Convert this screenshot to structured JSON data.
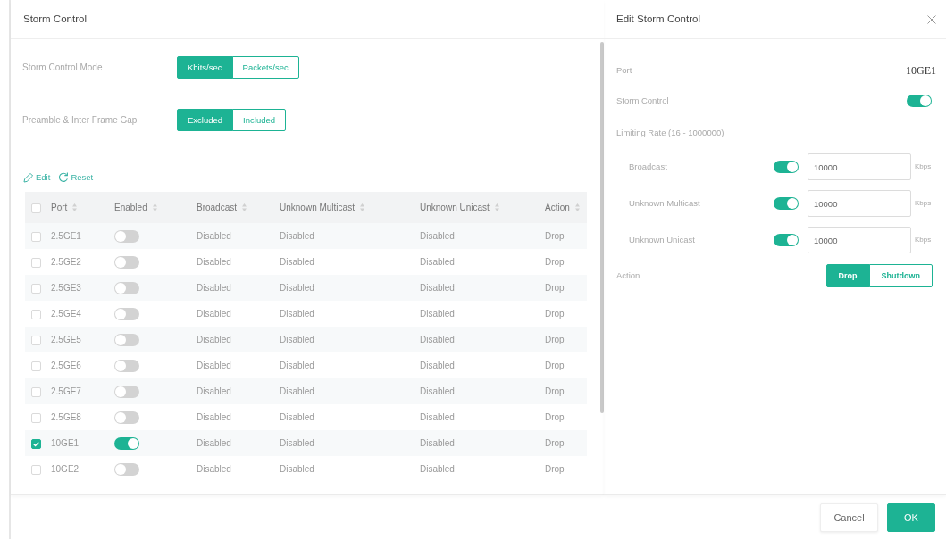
{
  "storm_control": {
    "title": "Storm Control",
    "settings": [
      {
        "label": "Storm Control Mode",
        "options": [
          {
            "label": "Kbits/sec",
            "selected": true
          },
          {
            "label": "Packets/sec",
            "selected": false
          }
        ]
      },
      {
        "label": "Preamble & Inter Frame Gap",
        "options": [
          {
            "label": "Excluded",
            "selected": true
          },
          {
            "label": "Included",
            "selected": false
          }
        ]
      }
    ],
    "toolbar": [
      {
        "kind": "edit",
        "label": "Edit"
      },
      {
        "kind": "reset",
        "label": "Reset"
      }
    ],
    "table": {
      "all_checked": false,
      "columns": [
        "Port",
        "Enabled",
        "Broadcast",
        "Unknown Multicast",
        "Unknown Unicast",
        "Action"
      ],
      "rows": [
        {
          "checked": false,
          "port": "2.5GE1",
          "enabled": false,
          "broadcast": "Disabled",
          "unknown_multicast": "Disabled",
          "unknown_unicast": "Disabled",
          "action": "Drop"
        },
        {
          "checked": false,
          "port": "2.5GE2",
          "enabled": false,
          "broadcast": "Disabled",
          "unknown_multicast": "Disabled",
          "unknown_unicast": "Disabled",
          "action": "Drop"
        },
        {
          "checked": false,
          "port": "2.5GE3",
          "enabled": false,
          "broadcast": "Disabled",
          "unknown_multicast": "Disabled",
          "unknown_unicast": "Disabled",
          "action": "Drop"
        },
        {
          "checked": false,
          "port": "2.5GE4",
          "enabled": false,
          "broadcast": "Disabled",
          "unknown_multicast": "Disabled",
          "unknown_unicast": "Disabled",
          "action": "Drop"
        },
        {
          "checked": false,
          "port": "2.5GE5",
          "enabled": false,
          "broadcast": "Disabled",
          "unknown_multicast": "Disabled",
          "unknown_unicast": "Disabled",
          "action": "Drop"
        },
        {
          "checked": false,
          "port": "2.5GE6",
          "enabled": false,
          "broadcast": "Disabled",
          "unknown_multicast": "Disabled",
          "unknown_unicast": "Disabled",
          "action": "Drop"
        },
        {
          "checked": false,
          "port": "2.5GE7",
          "enabled": false,
          "broadcast": "Disabled",
          "unknown_multicast": "Disabled",
          "unknown_unicast": "Disabled",
          "action": "Drop"
        },
        {
          "checked": false,
          "port": "2.5GE8",
          "enabled": false,
          "broadcast": "Disabled",
          "unknown_multicast": "Disabled",
          "unknown_unicast": "Disabled",
          "action": "Drop"
        },
        {
          "checked": true,
          "port": "10GE1",
          "enabled": true,
          "broadcast": "Disabled",
          "unknown_multicast": "Disabled",
          "unknown_unicast": "Disabled",
          "action": "Drop"
        },
        {
          "checked": false,
          "port": "10GE2",
          "enabled": false,
          "broadcast": "Disabled",
          "unknown_multicast": "Disabled",
          "unknown_unicast": "Disabled",
          "action": "Drop"
        }
      ]
    }
  },
  "edit_panel": {
    "title": "Edit Storm Control",
    "port": {
      "label": "Port",
      "value": "10GE1"
    },
    "storm_control": {
      "label": "Storm Control",
      "on": true
    },
    "limiting_rate": {
      "label": "Limiting Rate (16 - 1000000)",
      "rates": [
        {
          "label": "Broadcast",
          "on": true,
          "value": "10000",
          "unit": "Kbps"
        },
        {
          "label": "Unknown Multicast",
          "on": true,
          "value": "10000",
          "unit": "Kbps"
        },
        {
          "label": "Unknown Unicast",
          "on": true,
          "value": "10000",
          "unit": "Kbps"
        }
      ]
    },
    "action": {
      "label": "Action",
      "options": [
        {
          "label": "Drop",
          "selected": true
        },
        {
          "label": "Shutdown",
          "selected": false
        }
      ]
    },
    "buttons": [
      {
        "kind": "secondary",
        "label": "Cancel"
      },
      {
        "kind": "primary",
        "label": "OK"
      }
    ]
  }
}
